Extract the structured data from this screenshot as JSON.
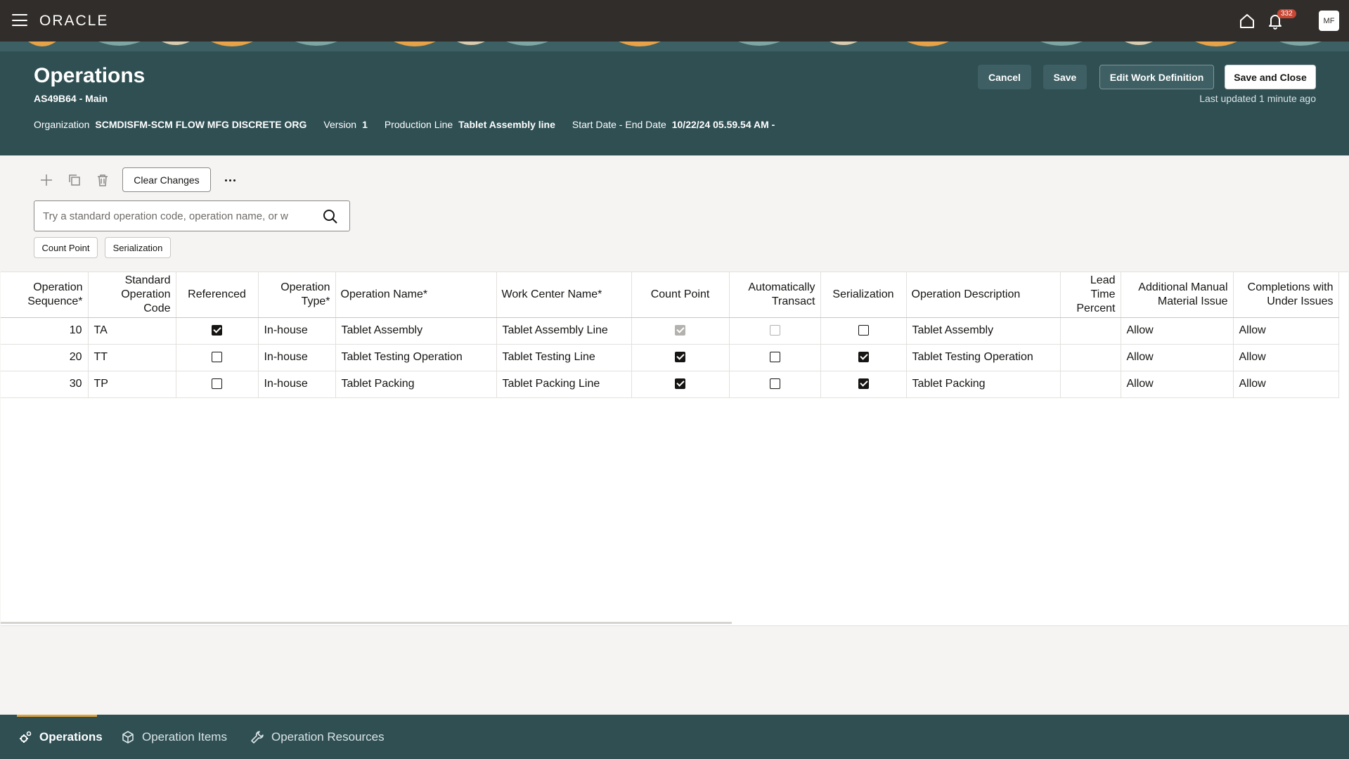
{
  "topbar": {
    "logo": "ORACLE",
    "notification_count": "332",
    "avatar_initials": "MF"
  },
  "header": {
    "title": "Operations",
    "subtitle": "AS49B64 - Main",
    "organization_label": "Organization",
    "organization_value": "SCMDISFM-SCM FLOW MFG DISCRETE ORG",
    "version_label": "Version",
    "version_value": "1",
    "production_line_label": "Production Line",
    "production_line_value": "Tablet Assembly line",
    "dates_label": "Start Date - End Date",
    "dates_value": "10/22/24 05.59.54 AM -",
    "cancel_label": "Cancel",
    "save_label": "Save",
    "edit_label": "Edit Work Definition",
    "save_close_label": "Save and Close",
    "last_updated": "Last updated 1 minute ago"
  },
  "toolbar": {
    "clear_changes_label": "Clear Changes"
  },
  "search": {
    "placeholder": "Try a standard operation code, operation name, or w"
  },
  "filters": {
    "chips": [
      "Count Point",
      "Serialization"
    ]
  },
  "table": {
    "columns": [
      "Operation Sequence*",
      "Standard Operation Code",
      "Referenced",
      "Operation Type*",
      "Operation Name*",
      "Work Center Name*",
      "Count Point",
      "Automatically Transact",
      "Serialization",
      "Operation Description",
      "Lead Time Percent",
      "Additional Manual Material Issue",
      "Completions with Under Issues"
    ],
    "rows": [
      {
        "seq": "10",
        "code": "TA",
        "referenced": true,
        "type": "In-house",
        "name": "Tablet Assembly",
        "work_center": "Tablet Assembly Line",
        "count_point": true,
        "count_point_disabled": true,
        "auto_transact": false,
        "auto_transact_disabled": true,
        "serialization": false,
        "description": "Tablet Assembly",
        "lead_time": "",
        "manual_issue": "Allow",
        "under_issues": "Allow"
      },
      {
        "seq": "20",
        "code": "TT",
        "referenced": false,
        "type": "In-house",
        "name": "Tablet Testing Operation",
        "work_center": "Tablet Testing Line",
        "count_point": true,
        "count_point_disabled": false,
        "auto_transact": false,
        "auto_transact_disabled": false,
        "serialization": true,
        "description": "Tablet Testing Operation",
        "lead_time": "",
        "manual_issue": "Allow",
        "under_issues": "Allow"
      },
      {
        "seq": "30",
        "code": "TP",
        "referenced": false,
        "type": "In-house",
        "name": "Tablet Packing",
        "work_center": "Tablet Packing Line",
        "count_point": true,
        "count_point_disabled": false,
        "auto_transact": false,
        "auto_transact_disabled": false,
        "serialization": true,
        "description": "Tablet Packing",
        "lead_time": "",
        "manual_issue": "Allow",
        "under_issues": "Allow"
      }
    ]
  },
  "bottom_tabs": [
    {
      "label": "Operations",
      "icon": "gears-icon",
      "active": true
    },
    {
      "label": "Operation Items",
      "icon": "cube-icon",
      "active": false
    },
    {
      "label": "Operation Resources",
      "icon": "wrench-icon",
      "active": false
    }
  ],
  "colors": {
    "topbar": "#312d2a",
    "header": "#2f4f53",
    "accent": "#e0a23e",
    "badge": "#c74634"
  }
}
